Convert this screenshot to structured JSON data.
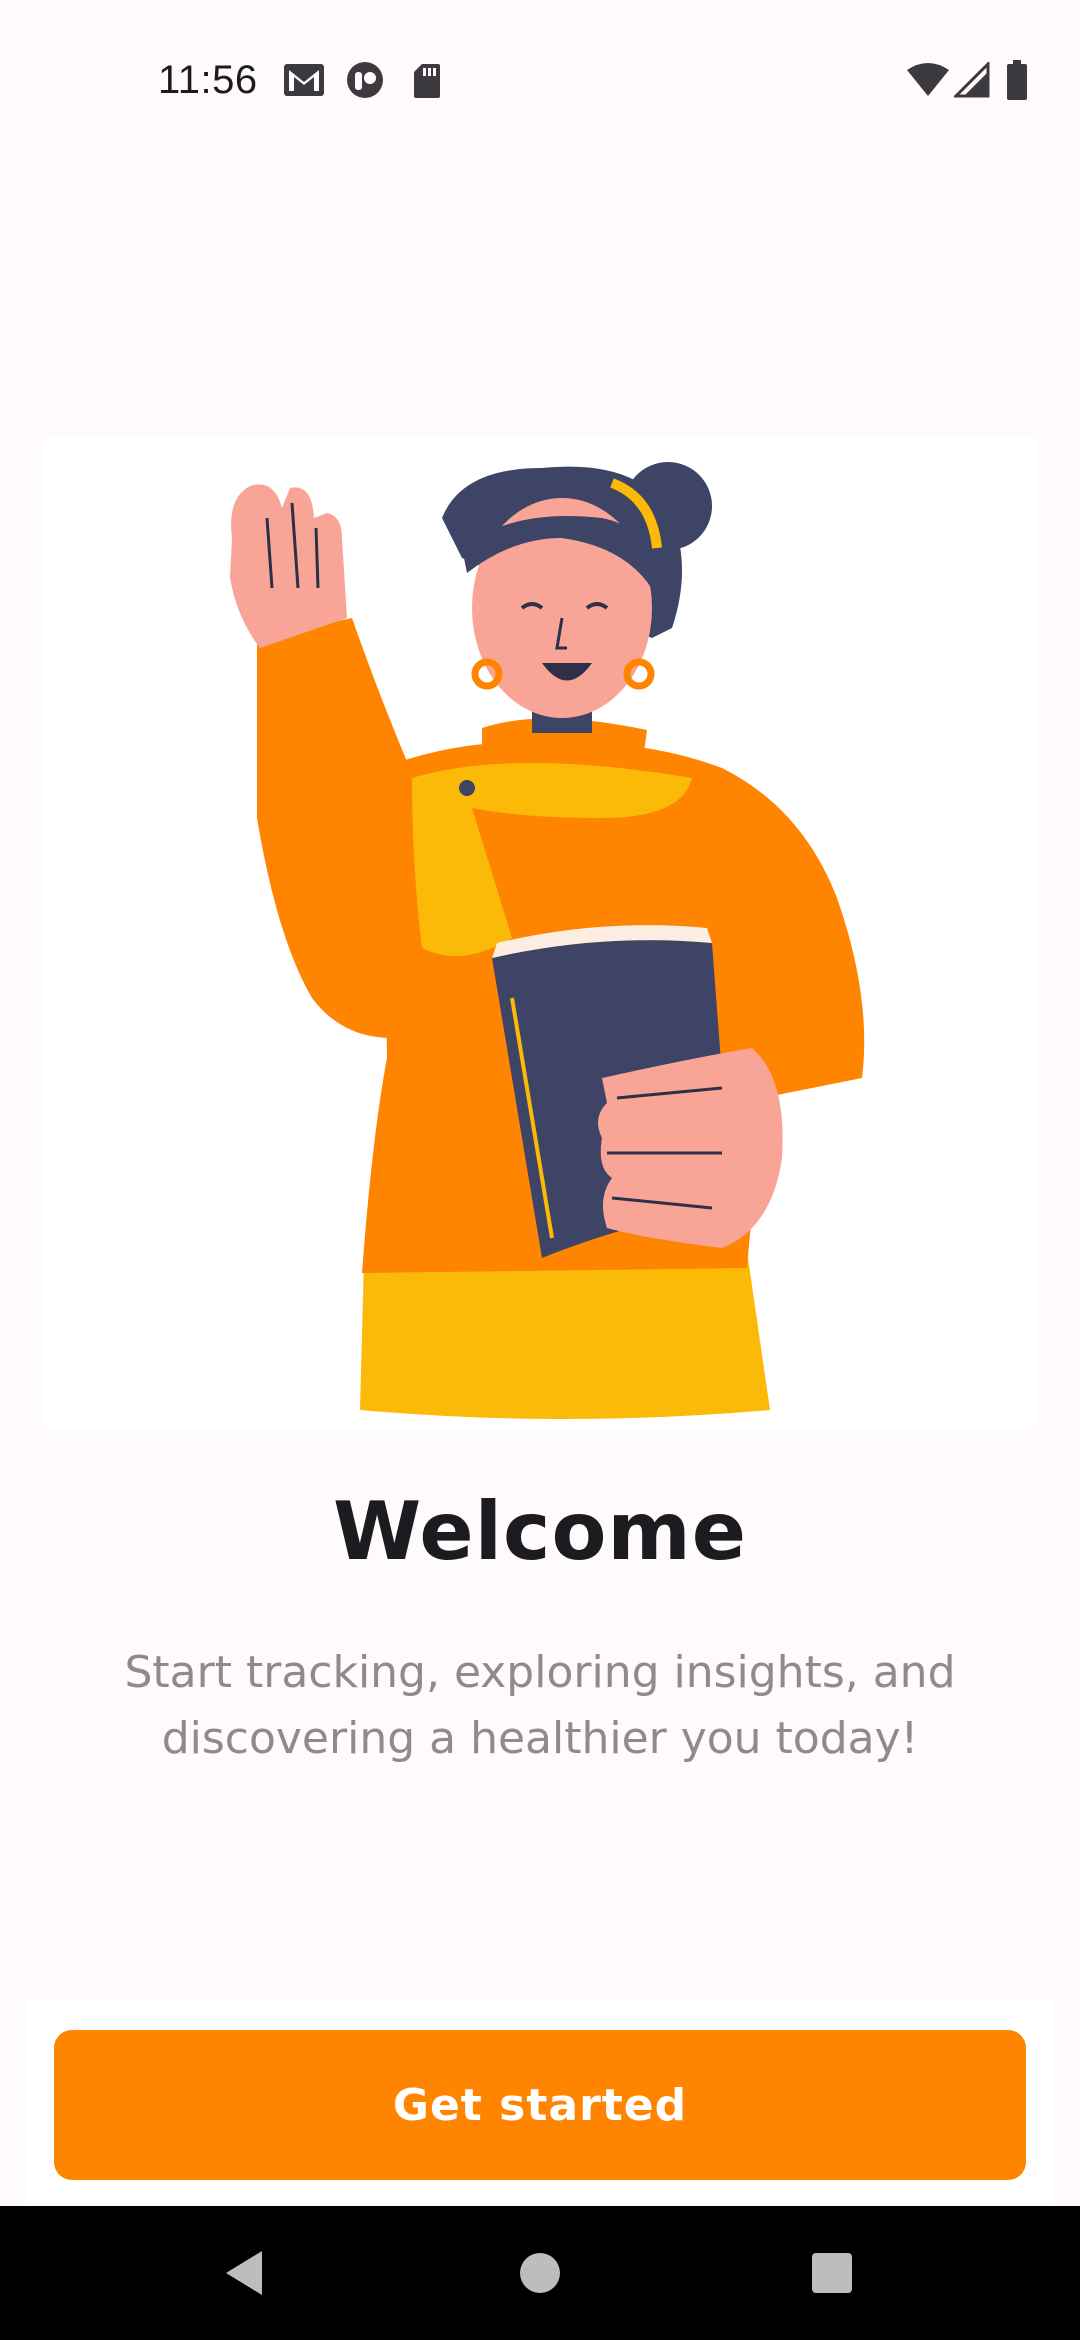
{
  "status_bar": {
    "time": "11:56",
    "icons_left": [
      "gmail-icon",
      "app-notification-icon",
      "sd-card-icon"
    ],
    "icons_right": [
      "wifi-icon",
      "cell-signal-icon",
      "battery-icon"
    ]
  },
  "onboarding": {
    "illustration": "woman-waving-holding-book-illustration",
    "title": "Welcome",
    "subtitle": "Start tracking, exploring insights, and discovering a healthier you today!",
    "cta_label": "Get started"
  },
  "nav_bar": {
    "buttons": [
      "back",
      "home",
      "recents"
    ]
  },
  "colors": {
    "accent": "#FF8400",
    "background": "#FFFBFD",
    "title": "#1C1B1F",
    "subtitle": "#8E8A8F"
  }
}
